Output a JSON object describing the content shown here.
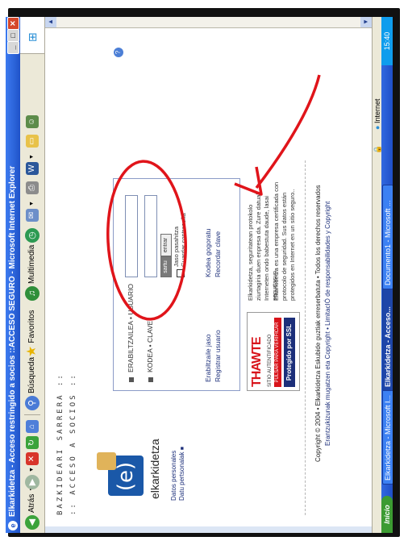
{
  "window": {
    "title": "Elkarkidetza - Acceso restringido a socios ::ACCESO SEGURO - Microsoft Internet Explorer"
  },
  "toolbar": {
    "back": "Atrás",
    "search": "Búsqueda",
    "favorites": "Favoritos",
    "multimedia": "Multimedia"
  },
  "page": {
    "header1": "BAZKIDEARI SARRERA ::",
    "header2": ":: ACCESO A SOCIOS ::",
    "brand": "elkarkidetza",
    "personal1": "Datos personales",
    "personal2": "Datu pertsonalak",
    "user_label": "ERABILTZAILEA • USUARIO",
    "key_label": "KODEA • CLAVE",
    "sartu": "sartu",
    "entrar": "entrar",
    "remember1": "Jaso pasahitza",
    "remember2": "Guardar contraseña",
    "link_erabiltzaile": "Erabiltzaile jaso",
    "link_registrar": "Registrar usuario",
    "link_kodea": "Kodea gogoratu",
    "link_recordar": "Recordar clave",
    "thawte_logo": "THAWTE",
    "thawte_sub": "SITIO AUTENTIFICADO",
    "thawte_click": "PULSAR PARA VERIFICAR",
    "thawte_ssl": "Protegido por SSL",
    "para_eu": "Elkarkidetza, seguritatean protokolo ziurtagiria duen enpresa da. Zure datuak Interneten ondo babestuta daude, lasai segurtasun.",
    "para_es": "Elkarkidetza es una empresa certificada con protocolo de seguridad. Sus datos están protegidos en Internet en un sitio seguro..",
    "footer1": "Copyright © 2004 • Elkarkidetza Eskubide guztiak erreserbatuta • Todos los derechos reservados",
    "footer2": "Erantzukizunak mugatzen eta Copyright  •  LimitacIÓ de responsabilidades y Copyright"
  },
  "annotation": {
    "color": "#e0141a"
  },
  "taskbar": {
    "start": "Inicio",
    "task1": "Elkarkidetza - Microsoft I...",
    "task2": "Elkarkidetza - Acceso...",
    "task3": "Documento1 - Microsoft ...",
    "clock": "15:40"
  },
  "status": {
    "internet": "Internet"
  }
}
